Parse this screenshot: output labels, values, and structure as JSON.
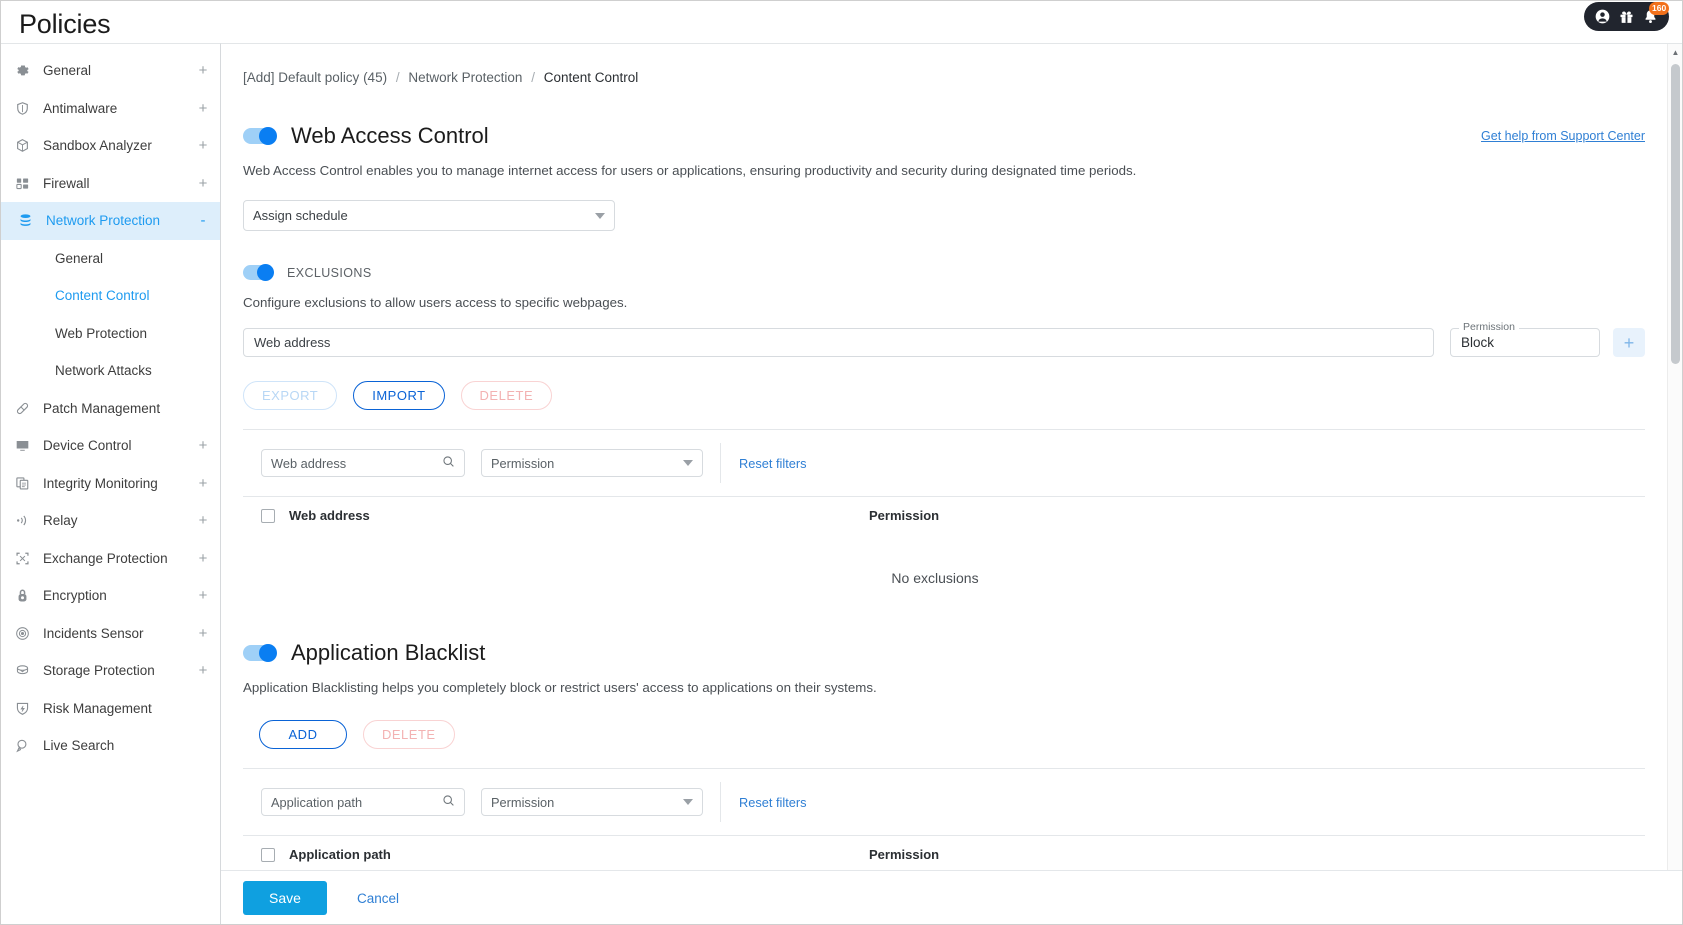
{
  "header": {
    "title": "Policies",
    "user_icon": "account-icon",
    "gift_icon": "gift-icon",
    "bell_icon": "bell-icon",
    "notification_count": "160"
  },
  "sidebar": {
    "items": [
      {
        "label": "General",
        "icon": "gear-icon",
        "expand": "+",
        "active": false
      },
      {
        "label": "Antimalware",
        "icon": "shield-icon",
        "expand": "+",
        "active": false
      },
      {
        "label": "Sandbox Analyzer",
        "icon": "box-icon",
        "expand": "+",
        "active": false
      },
      {
        "label": "Firewall",
        "icon": "firewall-icon",
        "expand": "+",
        "active": false
      },
      {
        "label": "Network Protection",
        "icon": "database-icon",
        "expand": "-",
        "active": true
      },
      {
        "label": "Patch Management",
        "icon": "bandage-icon",
        "expand": "",
        "active": false
      },
      {
        "label": "Device Control",
        "icon": "monitor-icon",
        "expand": "+",
        "active": false
      },
      {
        "label": "Integrity Monitoring",
        "icon": "documents-icon",
        "expand": "+",
        "active": false
      },
      {
        "label": "Relay",
        "icon": "broadcast-icon",
        "expand": "+",
        "active": false
      },
      {
        "label": "Exchange Protection",
        "icon": "exchange-icon",
        "expand": "+",
        "active": false
      },
      {
        "label": "Encryption",
        "icon": "lock-icon",
        "expand": "+",
        "active": false
      },
      {
        "label": "Incidents Sensor",
        "icon": "target-icon",
        "expand": "+",
        "active": false
      },
      {
        "label": "Storage Protection",
        "icon": "storage-icon",
        "expand": "+",
        "active": false
      },
      {
        "label": "Risk Management",
        "icon": "risk-icon",
        "expand": "",
        "active": false
      },
      {
        "label": "Live Search",
        "icon": "search-doc-icon",
        "expand": "",
        "active": false
      }
    ],
    "sub_items": [
      {
        "label": "General",
        "active": false
      },
      {
        "label": "Content Control",
        "active": true
      },
      {
        "label": "Web Protection",
        "active": false
      },
      {
        "label": "Network Attacks",
        "active": false
      }
    ]
  },
  "breadcrumb": {
    "policy": "[Add] Default policy (45)",
    "section": "Network Protection",
    "page": "Content Control",
    "separator": "/"
  },
  "support": {
    "link_label": "Get help from Support Center"
  },
  "web_access_control": {
    "title": "Web Access Control",
    "enabled": true,
    "description": "Web Access Control enables you to manage internet access for users or applications, ensuring productivity and security during designated time periods.",
    "schedule_select_value": "Assign schedule",
    "exclusions": {
      "toggle_label": "EXCLUSIONS",
      "enabled": true,
      "description": "Configure exclusions to allow users access to specific webpages.",
      "address_input_placeholder": "Web address",
      "address_input_value": "",
      "permission_legend": "Permission",
      "permission_value": "Block",
      "add_button_icon": "plus-icon",
      "buttons": {
        "export": "EXPORT",
        "import": "IMPORT",
        "delete": "DELETE"
      },
      "filters": {
        "search_placeholder": "Web address",
        "search_icon": "search-icon",
        "permission_filter": "Permission",
        "reset_label": "Reset filters"
      },
      "table": {
        "col_address": "Web address",
        "col_permission": "Permission",
        "empty_message": "No exclusions"
      }
    }
  },
  "application_blacklist": {
    "title": "Application Blacklist",
    "enabled": true,
    "description": "Application Blacklisting helps you completely block or restrict users' access to applications on their systems.",
    "buttons": {
      "add": "ADD",
      "delete": "DELETE"
    },
    "filters": {
      "search_placeholder": "Application path",
      "search_icon": "search-icon",
      "permission_filter": "Permission",
      "reset_label": "Reset filters"
    },
    "table": {
      "col_path": "Application path",
      "col_permission": "Permission"
    }
  },
  "footer": {
    "save_label": "Save",
    "cancel_label": "Cancel"
  },
  "colors": {
    "accent_blue": "#0a7ef2",
    "link_blue": "#2f7fd4",
    "save_blue": "#0fa0e0",
    "active_nav_bg": "#ddeefb",
    "badge_orange": "#f2711c"
  }
}
